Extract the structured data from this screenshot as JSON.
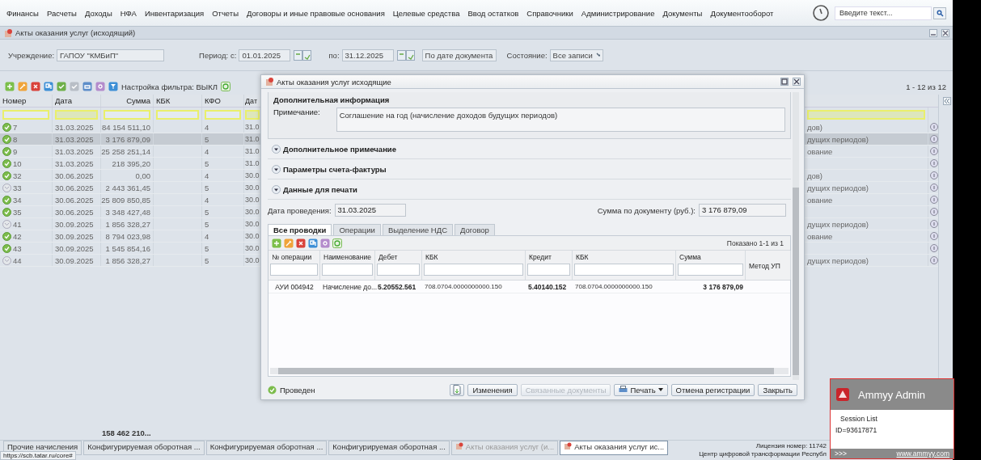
{
  "menu": [
    "Финансы",
    "Расчеты",
    "Доходы",
    "НФА",
    "Инвентаризация",
    "Отчеты",
    "Договоры и иные правовые основания",
    "Целевые средства",
    "Ввод остатков",
    "Справочники",
    "Администрирование",
    "Документы",
    "Документооборот"
  ],
  "search": {
    "placeholder": "Введите текст..."
  },
  "panel": {
    "title": "Акты оказания услуг (исходящий)"
  },
  "filters": {
    "institution_label": "Учреждение:",
    "institution": "ГАПОУ \"КМБиП\"",
    "period_label": "Период:",
    "from_label": "с:",
    "from": "01.01.2025",
    "to_label": "по:",
    "to": "31.12.2025",
    "date_mode": "По дате документа",
    "state_label": "Состояние:",
    "state": "Все записи"
  },
  "toolbar": {
    "filter_setting": "Настройка фильтра: ВЫКЛ",
    "paging": "1 - 12 из 12"
  },
  "grid": {
    "columns": [
      "Номер",
      "Дата",
      "Сумма",
      "КБК",
      "КФО",
      "Дат"
    ],
    "rows": [
      {
        "number": "7",
        "date": "31.03.2025",
        "sum": "84 154 511,10",
        "kfo": "4",
        "column_6": "31.0",
        "column_7": "дов)",
        "posted": true,
        "selected": false
      },
      {
        "number": "8",
        "date": "31.03.2025",
        "sum": "3 176 879,09",
        "kfo": "5",
        "column_6": "31.0",
        "column_7": "дущих периодов)",
        "posted": true,
        "selected": true
      },
      {
        "number": "9",
        "date": "31.03.2025",
        "sum": "25 258 251,14",
        "kfo": "4",
        "column_6": "31.0",
        "column_7": "ование",
        "posted": true,
        "selected": false
      },
      {
        "number": "10",
        "date": "31.03.2025",
        "sum": "218 395,20",
        "kfo": "5",
        "column_6": "31.0",
        "posted": true,
        "selected": false
      },
      {
        "number": "32",
        "date": "30.06.2025",
        "sum": "0,00",
        "kfo": "4",
        "column_6": "30.0",
        "column_7": "дов)",
        "posted": true,
        "selected": false
      },
      {
        "number": "33",
        "date": "30.06.2025",
        "sum": "2 443 361,45",
        "kfo": "5",
        "column_6": "30.0",
        "column_7": "дущих периодов)",
        "posted": false,
        "selected": false
      },
      {
        "number": "34",
        "date": "30.06.2025",
        "sum": "25 809 850,85",
        "kfo": "4",
        "column_6": "30.0",
        "column_7": "ование",
        "posted": true,
        "selected": false
      },
      {
        "number": "35",
        "date": "30.06.2025",
        "sum": "3 348 427,48",
        "kfo": "5",
        "column_6": "30.0",
        "posted": true,
        "selected": false
      },
      {
        "number": "41",
        "date": "30.09.2025",
        "sum": "1 856 328,27",
        "kfo": "5",
        "column_6": "30.0",
        "column_7": "дущих периодов)",
        "posted": false,
        "selected": false
      },
      {
        "number": "42",
        "date": "30.09.2025",
        "sum": "8 794 023,98",
        "kfo": "4",
        "column_6": "30.0",
        "column_7": "ование",
        "posted": true,
        "selected": false
      },
      {
        "number": "43",
        "date": "30.09.2025",
        "sum": "1 545 854,16",
        "kfo": "5",
        "column_6": "30.0",
        "posted": true,
        "selected": false
      },
      {
        "number": "44",
        "date": "30.09.2025",
        "sum": "1 856 328,27",
        "kfo": "5",
        "column_6": "30.0",
        "column_7": "дущих периодов)",
        "posted": false,
        "selected": false
      }
    ],
    "total": "158 462 210..."
  },
  "modal": {
    "title": "Акты оказания услуг исходящие",
    "info_title": "Дополнительная информация",
    "note_label": "Примечание:",
    "note": "Соглашение на год (начисление доходов будущих периодов)",
    "sections": [
      "Дополнительное примечание",
      "Параметры счета-фактуры",
      "Данные для печати"
    ],
    "date_label": "Дата проведения:",
    "date": "31.03.2025",
    "sum_label": "Сумма по документу (руб.):",
    "sum": "3 176 879,09",
    "tabs": [
      {
        "label": "Все проводки",
        "selected": true
      },
      {
        "label": "Операции",
        "selected": false
      },
      {
        "label": "Выделение НДС",
        "selected": false
      },
      {
        "label": "Договор",
        "selected": false
      }
    ],
    "paging": "Показано 1-1 из 1",
    "columns": [
      "№ операции",
      "Наименование",
      "Дебет",
      "КБК",
      "Кредит",
      "КБК",
      "Сумма",
      "Метод УП"
    ],
    "rows": [
      {
        "cells": [
          "АУИ 004942",
          "Начисление до...",
          "5.20552.561",
          "708.0704.0000000000.150",
          "5.40140.152",
          "708.0704.0000000000.150",
          "3 176 879,09"
        ]
      }
    ],
    "status": "Проведен",
    "buttons": [
      {
        "label": "Изменения",
        "disabled": false,
        "menu": false
      },
      {
        "label": "Связанные документы",
        "disabled": true,
        "menu": false
      },
      {
        "label": "Печать",
        "disabled": false,
        "menu": true
      },
      {
        "label": "Отмена регистрации",
        "disabled": false,
        "menu": false
      },
      {
        "label": "Закрыть",
        "disabled": false,
        "menu": false
      }
    ]
  },
  "taskbar": [
    {
      "label": "Прочие начисления",
      "active": false
    },
    {
      "label": "Конфигурируемая оборотная ...",
      "active": false
    },
    {
      "label": "Конфигурируемая оборотная ...",
      "active": false
    },
    {
      "label": "Конфигурируемая оборотная ...",
      "active": false
    },
    {
      "label": "Акты оказания услуг (и...",
      "active": false
    },
    {
      "label": "Акты оказания услуг ис...",
      "active": true
    }
  ],
  "license": [
    "Лицензия номер: 11742",
    "Центр цифровой трансформации Республ"
  ],
  "status_url": "https://scb.tatar.ru/core#",
  "ammyy": {
    "title": "Ammyy Admin",
    "list": "Session List",
    "id": "ID=93617871",
    "more": ">>>",
    "link": "www.ammyy.com"
  }
}
